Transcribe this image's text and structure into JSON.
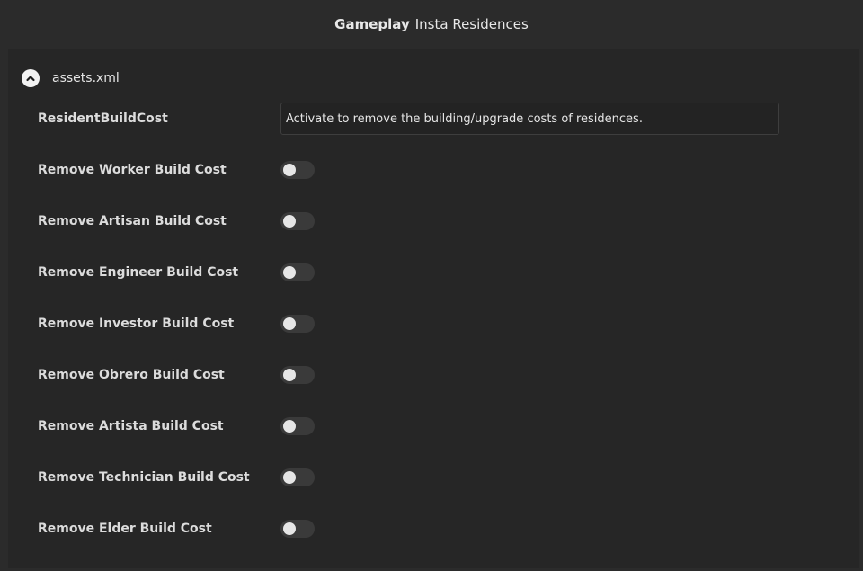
{
  "header": {
    "category": "Gameplay",
    "title": "Insta Residences"
  },
  "section": {
    "label": "assets.xml",
    "expanded": true
  },
  "resident_build_cost": {
    "label": "ResidentBuildCost",
    "description": "Activate to remove the building/upgrade costs of residences."
  },
  "options": [
    {
      "label": "Remove Worker Build Cost",
      "enabled": false
    },
    {
      "label": "Remove Artisan Build Cost",
      "enabled": false
    },
    {
      "label": "Remove Engineer Build Cost",
      "enabled": false
    },
    {
      "label": "Remove Investor Build Cost",
      "enabled": false
    },
    {
      "label": "Remove Obrero Build Cost",
      "enabled": false
    },
    {
      "label": "Remove Artista Build Cost",
      "enabled": false
    },
    {
      "label": "Remove Technician Build Cost",
      "enabled": false
    },
    {
      "label": "Remove Elder Build Cost",
      "enabled": false
    }
  ]
}
